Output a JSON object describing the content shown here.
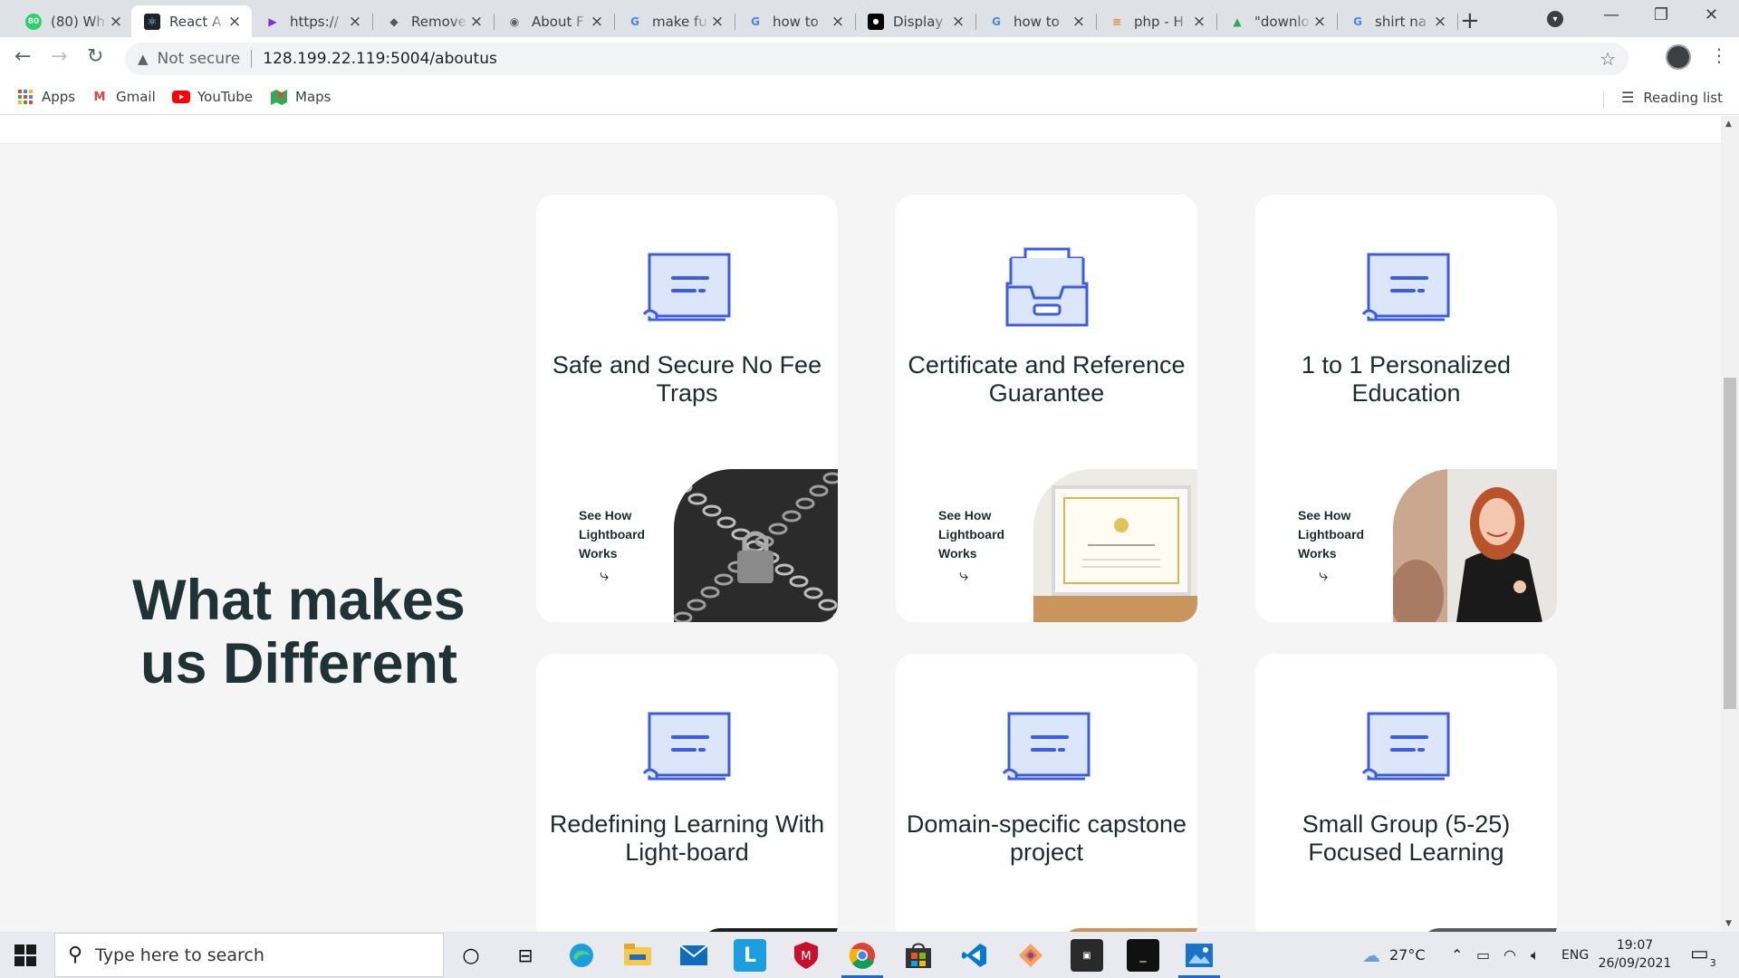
{
  "browser": {
    "tabs": [
      {
        "title": "(80) Wh",
        "favicon": "whatsapp-icon",
        "color": "#25d366",
        "glyph": "80"
      },
      {
        "title": "React A",
        "favicon": "react-icon",
        "color": "#20232a",
        "glyph": "⚛",
        "active": true
      },
      {
        "title": "https://",
        "favicon": "play-icon",
        "color": "#8a2be2",
        "glyph": "▶"
      },
      {
        "title": "Remove",
        "favicon": "grad-cap-icon",
        "color": "#555555",
        "glyph": "◆"
      },
      {
        "title": "About F",
        "favicon": "globe-icon",
        "color": "#5f6368",
        "glyph": "◉"
      },
      {
        "title": "make fu",
        "favicon": "google-icon",
        "color": "#4285f4",
        "glyph": "G"
      },
      {
        "title": "how to",
        "favicon": "google-icon",
        "color": "#4285f4",
        "glyph": "G"
      },
      {
        "title": "Display",
        "favicon": "medium-icon",
        "color": "#000000",
        "glyph": "●"
      },
      {
        "title": "how to",
        "favicon": "google-icon",
        "color": "#4285f4",
        "glyph": "G"
      },
      {
        "title": "php - H",
        "favicon": "stackoverflow-icon",
        "color": "#f48024",
        "glyph": "≡"
      },
      {
        "title": "\"downlo",
        "favicon": "image-icon",
        "color": "#34a853",
        "glyph": "▲"
      },
      {
        "title": "shirt na",
        "favicon": "google-icon",
        "color": "#4285f4",
        "glyph": "G"
      }
    ],
    "omnibox": {
      "security_label": "Not secure",
      "url": "128.199.22.119:5004/aboutus"
    },
    "bookmarks": [
      {
        "label": "Apps",
        "icon": "apps-grid-icon"
      },
      {
        "label": "Gmail",
        "icon": "gmail-icon"
      },
      {
        "label": "YouTube",
        "icon": "youtube-icon"
      },
      {
        "label": "Maps",
        "icon": "maps-icon"
      }
    ],
    "reading_list": "Reading list"
  },
  "page": {
    "heading": "What makes us Different",
    "see_how": "See How Lightboard Works",
    "cards": [
      {
        "title": "Safe and Secure No Fee Traps",
        "icon": "document-tray-icon",
        "photo": "chained-lock-photo"
      },
      {
        "title": "Certificate and Reference Guarantee",
        "icon": "file-cabinet-icon",
        "photo": "framed-certificate-photo"
      },
      {
        "title": "1 to 1 Personalized Education",
        "icon": "document-tray-icon",
        "photo": "smiling-tutor-photo"
      },
      {
        "title": "Redefining Learning With Light-board",
        "icon": "document-tray-icon"
      },
      {
        "title": "Domain-specific capstone project",
        "icon": "document-tray-icon"
      },
      {
        "title": "Small Group (5-25) Focused Learning",
        "icon": "document-tray-icon"
      }
    ],
    "colors": {
      "heading": "#1f3336",
      "icon_blue": "#3d5ce6",
      "icon_fill": "#dbe6fb",
      "page_bg": "#f5f5f5"
    }
  },
  "taskbar": {
    "search_placeholder": "Type here to search",
    "weather": "27°C",
    "language": "ENG",
    "time": "19:07",
    "date": "26/09/2021",
    "notification_count": "3"
  }
}
